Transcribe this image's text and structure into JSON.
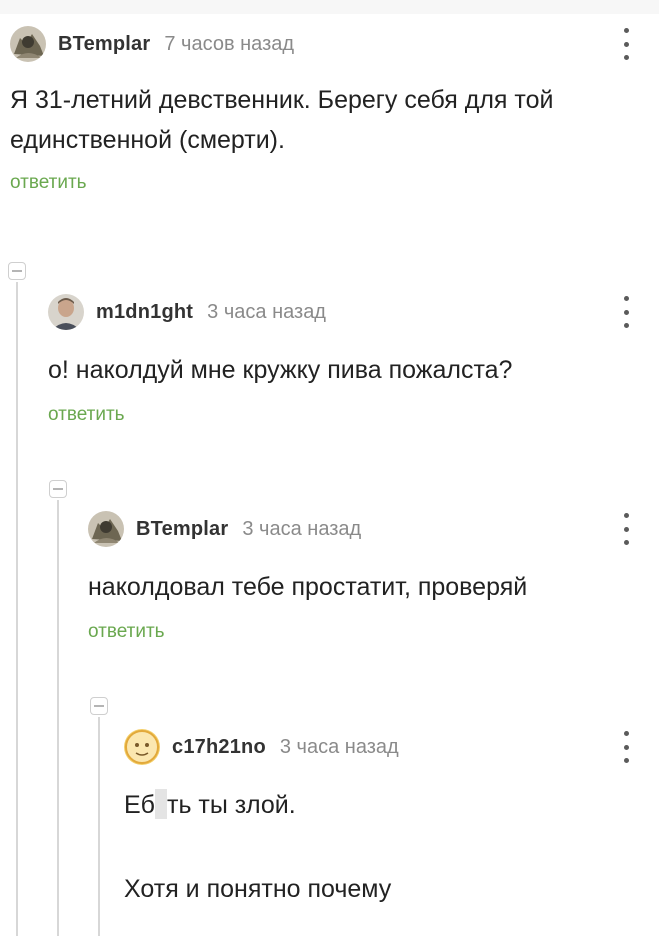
{
  "comments": [
    {
      "username": "BTemplar",
      "time": "7 часов назад",
      "text": "Я 31-летний девственник. Берегу себя для той единственной (смерти).",
      "reply": "ответить"
    },
    {
      "username": "m1dn1ght",
      "time": "3 часа назад",
      "text": "о! наколдуй мне кружку пива пожалста?",
      "reply": "ответить"
    },
    {
      "username": "BTemplar",
      "time": "3 часа назад",
      "text": "наколдовал тебе простатит, проверяй",
      "reply": "ответить"
    },
    {
      "username": "c17h21no",
      "time": "3 часа назад",
      "text_part1": "Еб",
      "text_part2": "ть ты злой.",
      "text_line2": "Хотя и понятно почему"
    }
  ],
  "icons": {
    "more": "vertical-ellipsis-icon",
    "collapse": "collapse-minus-icon"
  },
  "colors": {
    "reply_link": "#6aa84f",
    "username": "#333333",
    "time": "#8a8a8a"
  }
}
